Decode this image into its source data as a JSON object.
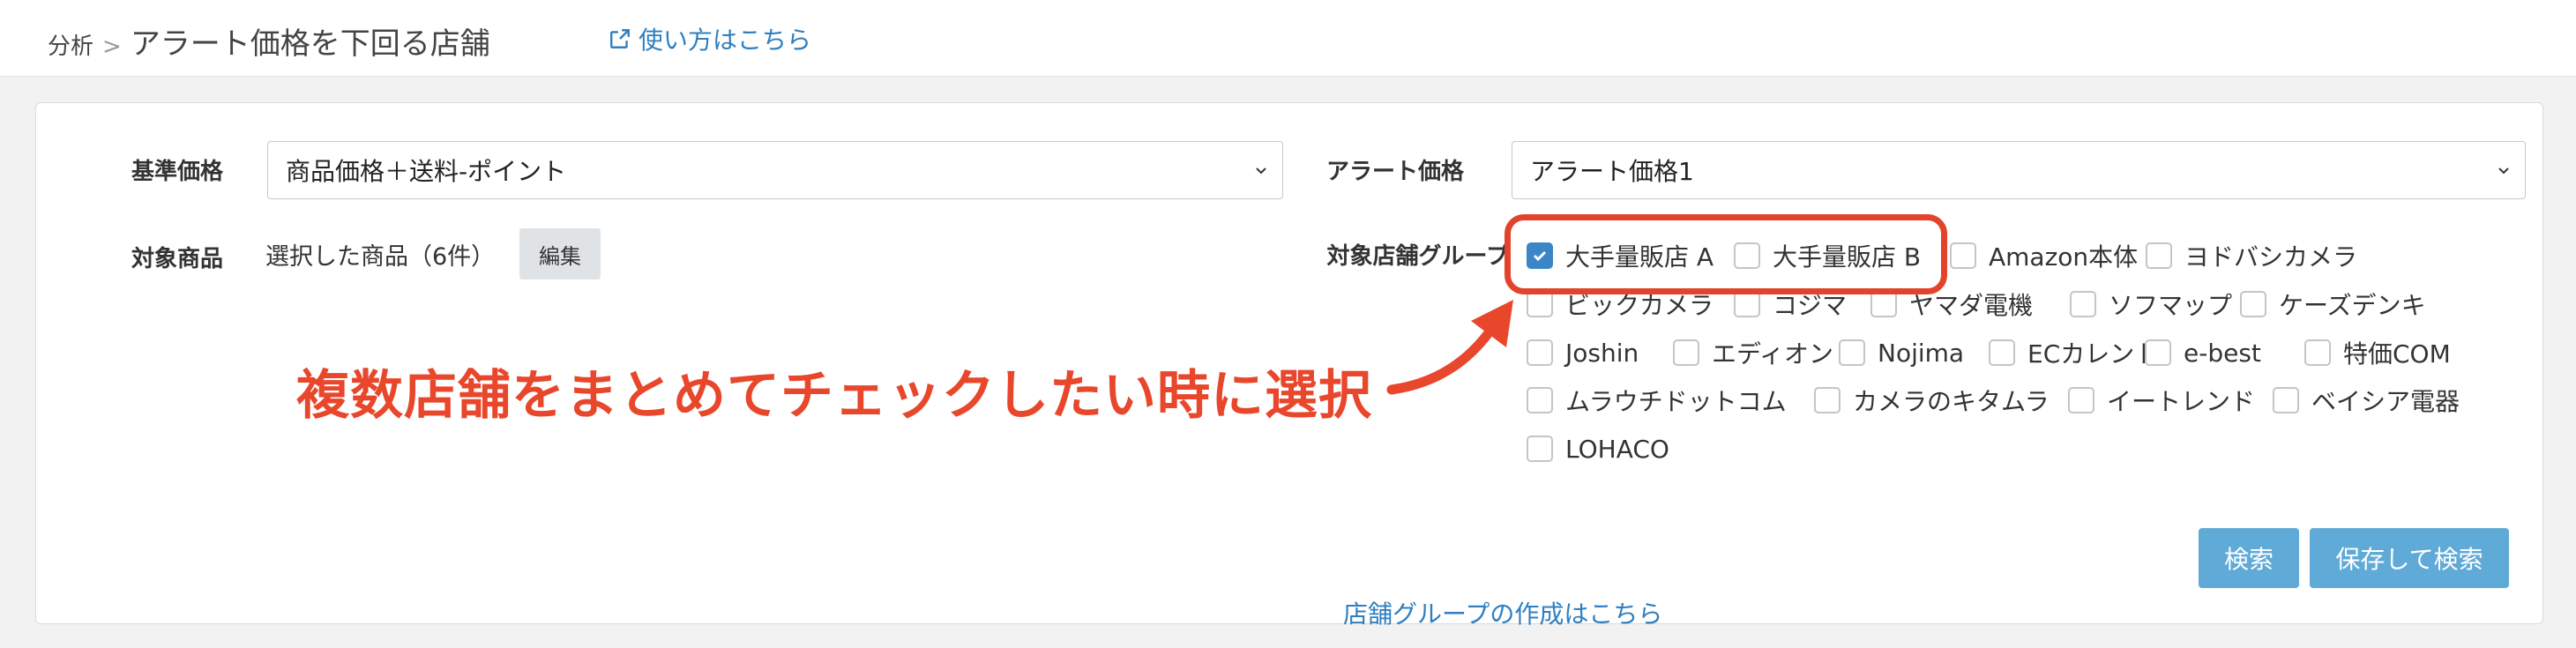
{
  "header": {
    "breadcrumb_parent": "分析",
    "breadcrumb_sep": ">",
    "page_title": "アラート価格を下回る店舗",
    "help_link": "使い方はこちら"
  },
  "form": {
    "base_price_label": "基準価格",
    "base_price_value": "商品価格＋送料-ポイント",
    "alert_price_label": "アラート価格",
    "alert_price_value": "アラート価格1",
    "target_product_label": "対象商品",
    "target_product_value": "選択した商品（6件）",
    "edit_button": "編集",
    "store_group_label": "対象店舗グループ",
    "stores": [
      {
        "name": "大手量販店 A",
        "checked": true
      },
      {
        "name": "大手量販店 B",
        "checked": false
      },
      {
        "name": "Amazon本体",
        "checked": false
      },
      {
        "name": "ヨドバシカメラ",
        "checked": false
      },
      {
        "name": "ビックカメラ",
        "checked": false
      },
      {
        "name": "コジマ",
        "checked": false
      },
      {
        "name": "ヤマダ電機",
        "checked": false
      },
      {
        "name": "ソフマップ",
        "checked": false
      },
      {
        "name": "ケーズデンキ",
        "checked": false
      },
      {
        "name": "Joshin",
        "checked": false
      },
      {
        "name": "エディオン",
        "checked": false
      },
      {
        "name": "Nojima",
        "checked": false
      },
      {
        "name": "ECカレント",
        "checked": false
      },
      {
        "name": "e-best",
        "checked": false
      },
      {
        "name": "特価COM",
        "checked": false
      },
      {
        "name": "ムラウチドットコム",
        "checked": false
      },
      {
        "name": "カメラのキタムラ",
        "checked": false
      },
      {
        "name": "イートレンド",
        "checked": false
      },
      {
        "name": "ベイシア電器",
        "checked": false
      },
      {
        "name": "LOHACO",
        "checked": false
      }
    ],
    "group_create_link": "店舗グループの作成はこちら",
    "search_button": "検索",
    "save_search_button": "保存して検索"
  },
  "annotation": {
    "text": "複数店舗をまとめてチェックしたい時に選択",
    "color": "#e8472c"
  },
  "colors": {
    "link": "#2f7fc0",
    "primary_button": "#5faad6",
    "checkbox_checked": "#3a86c8"
  }
}
